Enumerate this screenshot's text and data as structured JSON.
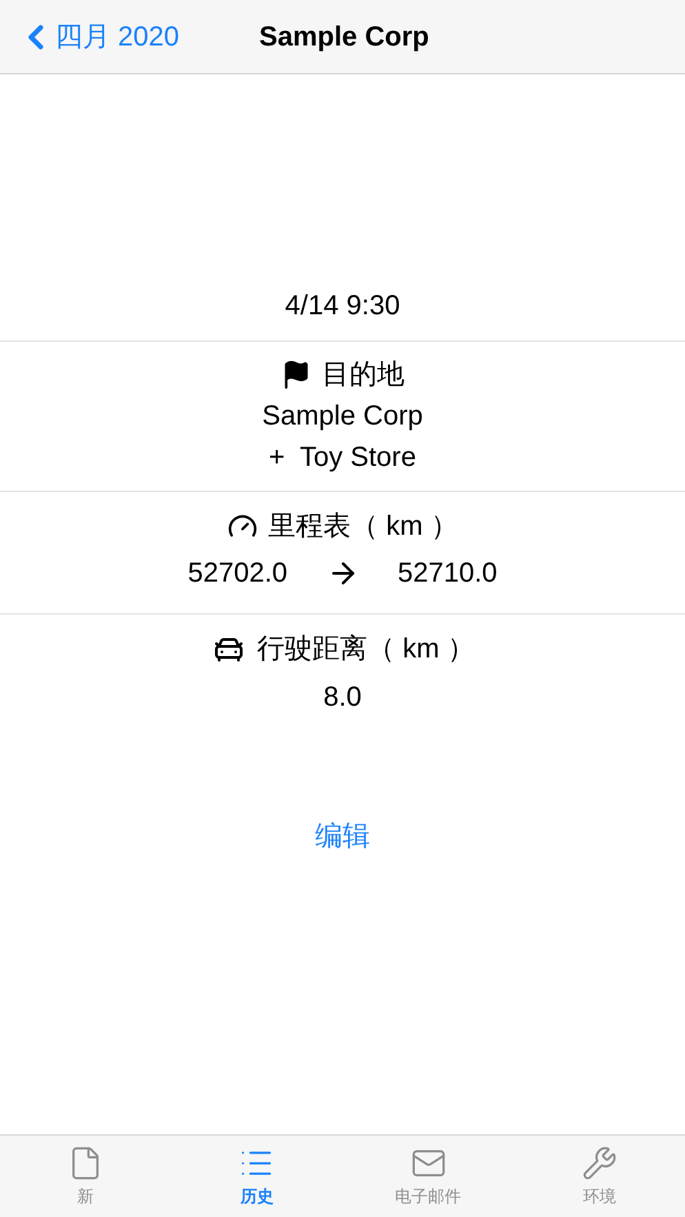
{
  "nav": {
    "back": "四月 2020",
    "title": "Sample Corp"
  },
  "date": "4/14 9:30",
  "destination": {
    "label": "目的地",
    "lines": [
      "Sample Corp",
      "+  Toy Store"
    ]
  },
  "odometer": {
    "label": "里程表（ km ）",
    "start": "52702.0",
    "end": "52710.0"
  },
  "distance": {
    "label": "行驶距离（ km ）",
    "value": "8.0"
  },
  "edit": "编辑",
  "tabs": [
    {
      "kind": "new",
      "label": "新",
      "selected": false
    },
    {
      "kind": "history",
      "label": "历史",
      "selected": true
    },
    {
      "kind": "email",
      "label": "电子邮件",
      "selected": false
    },
    {
      "kind": "settings",
      "label": "环境",
      "selected": false
    }
  ]
}
